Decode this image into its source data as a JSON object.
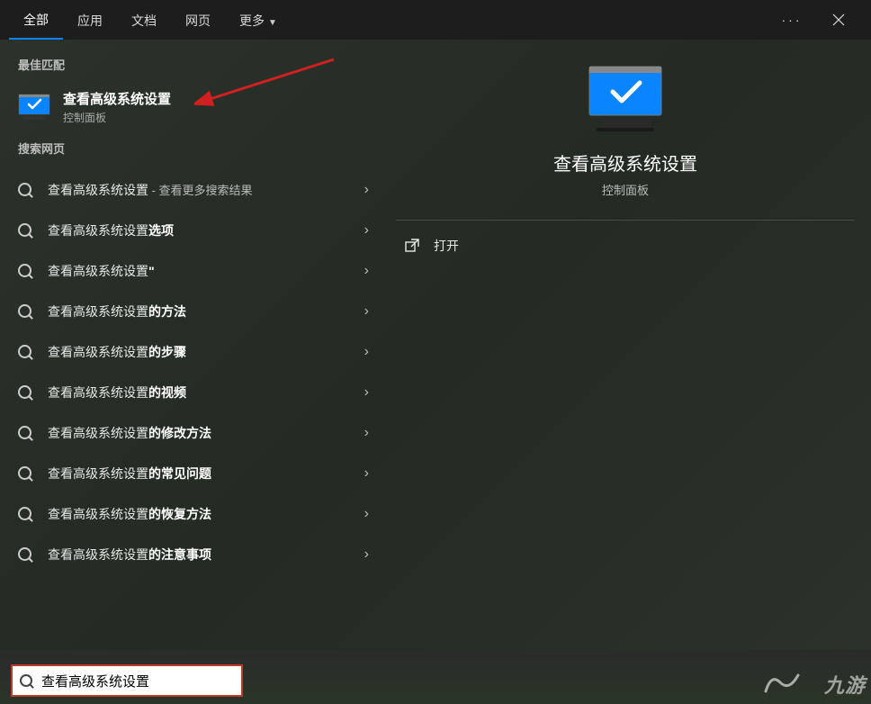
{
  "tabs": {
    "all": "全部",
    "apps": "应用",
    "docs": "文档",
    "web": "网页",
    "more": "更多"
  },
  "sections": {
    "best_match": "最佳匹配",
    "web_search": "搜索网页"
  },
  "best_match": {
    "title": "查看高级系统设置",
    "subtitle": "控制面板"
  },
  "web_results": [
    {
      "prefix": "查看高级系统设置",
      "suffix": "",
      "extra": " - 查看更多搜索结果"
    },
    {
      "prefix": "查看高级系统设置",
      "suffix": "选项",
      "extra": ""
    },
    {
      "prefix": "查看高级系统设置",
      "suffix": "\"",
      "extra": ""
    },
    {
      "prefix": "查看高级系统设置",
      "suffix": "的方法",
      "extra": ""
    },
    {
      "prefix": "查看高级系统设置",
      "suffix": "的步骤",
      "extra": ""
    },
    {
      "prefix": "查看高级系统设置",
      "suffix": "的视频",
      "extra": ""
    },
    {
      "prefix": "查看高级系统设置",
      "suffix": "的修改方法",
      "extra": ""
    },
    {
      "prefix": "查看高级系统设置",
      "suffix": "的常见问题",
      "extra": ""
    },
    {
      "prefix": "查看高级系统设置",
      "suffix": "的恢复方法",
      "extra": ""
    },
    {
      "prefix": "查看高级系统设置",
      "suffix": "的注意事项",
      "extra": ""
    }
  ],
  "preview": {
    "title": "查看高级系统设置",
    "subtitle": "控制面板",
    "open_label": "打开"
  },
  "searchbox": {
    "value": "查看高级系统设置"
  },
  "watermark": "九游"
}
